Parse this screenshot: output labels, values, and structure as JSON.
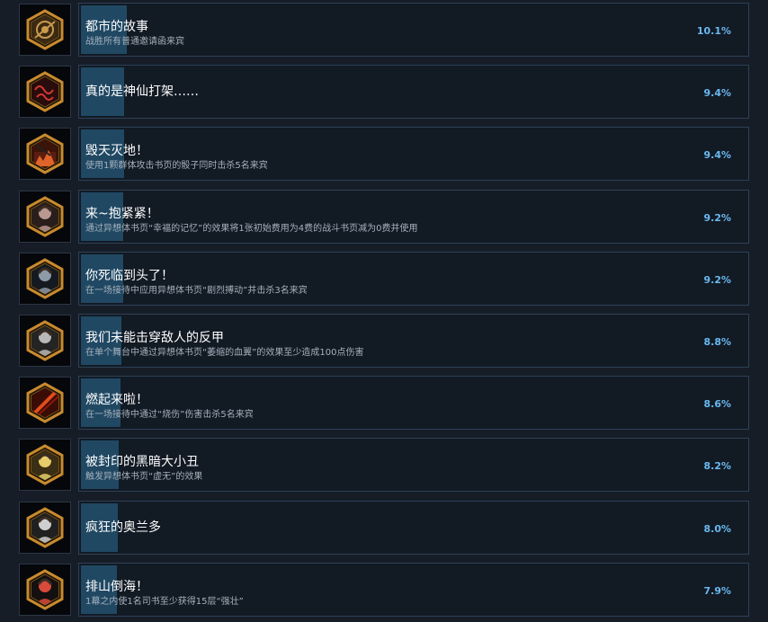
{
  "achievements": [
    {
      "title": "都市的故事",
      "description": "战胜所有普通邀请函来宾",
      "percent_label": "10.1%",
      "percent": 10.1,
      "icon": "gear-scroll-icon",
      "theme": "#c99a4a",
      "bg": "#3a2a14"
    },
    {
      "title": "真的是神仙打架……",
      "description": "",
      "percent_label": "9.4%",
      "percent": 9.4,
      "icon": "red-script-icon",
      "theme": "#d13a32",
      "bg": "#2a0c0c"
    },
    {
      "title": "毁天灭地！",
      "description": "使用1颗群体攻击书页的骰子同时击杀5名来宾",
      "percent_label": "9.4%",
      "percent": 9.4,
      "icon": "burning-building-icon",
      "theme": "#e0642a",
      "bg": "#3a1408"
    },
    {
      "title": "来~抱紧紧！",
      "description": "通过异想体书页“幸福的记忆”的效果将1张初始费用为4费的战斗书页减为0费并使用",
      "percent_label": "9.2%",
      "percent": 9.2,
      "icon": "girl-portrait-icon",
      "theme": "#b89890",
      "bg": "#2a1e1c"
    },
    {
      "title": "你死临到头了！",
      "description": "在一场接待中应用异想体书页“剧烈搏动”并击杀3名来宾",
      "percent_label": "9.2%",
      "percent": 9.2,
      "icon": "suited-man-icon",
      "theme": "#8e9aa6",
      "bg": "#151a20"
    },
    {
      "title": "我们未能击穿敌人的反甲",
      "description": "在单个舞台中通过异想体书页“萎缩的血翼”的效果至少造成100点伤害",
      "percent_label": "8.8%",
      "percent": 8.8,
      "icon": "gray-hair-man-icon",
      "theme": "#b8b8b8",
      "bg": "#242424"
    },
    {
      "title": "燃起来啦！",
      "description": "在一场接待中通过“烧伤”伤害击杀5名来宾",
      "percent_label": "8.6%",
      "percent": 8.6,
      "icon": "flame-slash-icon",
      "theme": "#e24b1c",
      "bg": "#3a0c06"
    },
    {
      "title": "被封印的黑暗大小丑",
      "description": "触发异想体书页“虚无”的效果",
      "percent_label": "8.2%",
      "percent": 8.2,
      "icon": "blonde-woman-icon",
      "theme": "#e6cc6a",
      "bg": "#3a2e14"
    },
    {
      "title": "疯狂的奥兰多",
      "description": "",
      "percent_label": "8.0%",
      "percent": 8.0,
      "icon": "mad-figure-icon",
      "theme": "#cfcfcf",
      "bg": "#202020"
    },
    {
      "title": "排山倒海！",
      "description": "1幕之内使1名司书至少获得15层“强壮”",
      "percent_label": "7.9%",
      "percent": 7.9,
      "icon": "hat-figure-icon",
      "theme": "#d94a3a",
      "bg": "#141010"
    }
  ],
  "colors": {
    "background": "#161d27",
    "card": "#121a24",
    "card_border": "#2e4158",
    "progress_fill": "#204863",
    "percent_text": "#6ab9f0",
    "hex_frame": "#c88a2e"
  }
}
